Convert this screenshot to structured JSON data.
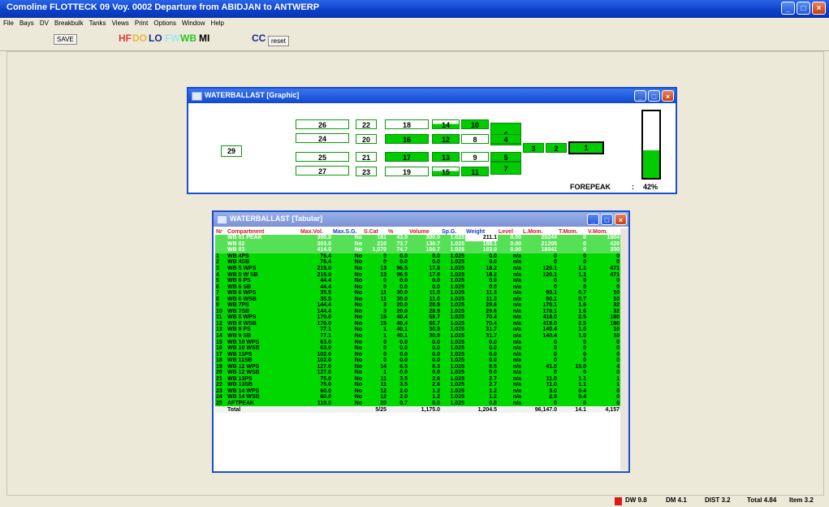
{
  "app": {
    "title": "Comoline FLOTTECK 09  Voy. 0002 Departure from ABIDJAN to ANTWERP",
    "menu": [
      "File",
      "Bays",
      "DV",
      "Breakbulk",
      "Tanks",
      "Views",
      "Print",
      "Options",
      "Window",
      "Help"
    ]
  },
  "toolbar": {
    "save": "SAVE",
    "hf": "HF",
    "do": "DO",
    "lo": "LO",
    "fw": "FW",
    "wb": "WB",
    "mi": "MI",
    "cc": "CC",
    "reset": "reset",
    "colors": {
      "hf": "#e23a3a",
      "do": "#e8b840",
      "lo": "#1a2a8a",
      "fw": "#9de8f0",
      "wb": "#26c826",
      "mi": "#000000"
    }
  },
  "graphic_window": {
    "title": "WATERBALLAST  [Graphic]",
    "tanks": {
      "t29": "29",
      "r1": [
        "26",
        "22",
        "18",
        "14",
        "10",
        "6"
      ],
      "r2": [
        "24",
        "20",
        "16",
        "12",
        "8",
        "4"
      ],
      "r3": [
        "25",
        "21",
        "17",
        "13",
        "9",
        "5"
      ],
      "r4": [
        "27",
        "23",
        "19",
        "15",
        "11",
        "7"
      ],
      "chain": [
        "3",
        "2",
        "1"
      ]
    },
    "selected_tank": "FOREPEAK",
    "selected_sep": ":",
    "selected_pct": "42%",
    "fill_level": 0.42
  },
  "table_window": {
    "title": "WATERBALLAST  [Tabular]",
    "headers": [
      "Nr",
      "Compartment",
      "Max.Vol.",
      "Max.S.G.",
      "S.Cat",
      "%",
      "Volume",
      "Sp.G.",
      "Weight",
      "Level",
      "L.Mom.",
      "T.Mom.",
      "V.Mom."
    ],
    "rows": [
      [
        "",
        "WB 01 PEAK",
        "300.0",
        "No",
        "161",
        "43.0",
        "300.0",
        "1.025",
        "211.1",
        "0.00",
        "20244",
        "0",
        "1604"
      ],
      [
        "",
        "WB 02",
        "303.0",
        "No",
        "210",
        "73.7",
        "130.7",
        "1.025",
        "188.1",
        "0.00",
        "21205",
        "0",
        "420"
      ],
      [
        "",
        "WB 03",
        "414.0",
        "No",
        "1,070",
        "74.7",
        "150.7",
        "1.025",
        "183.0",
        "0.00",
        "18041",
        "0",
        "350"
      ],
      [
        "1",
        "WB 4PS",
        "76.4",
        "No",
        "0",
        "0.0",
        "0.0",
        "1.025",
        "0.0",
        "n/a",
        "0",
        "0",
        "0"
      ],
      [
        "2",
        "WB 4SB",
        "76.4",
        "No",
        "0",
        "0.0",
        "0.0",
        "1.025",
        "0.0",
        "n/a",
        "0",
        "0",
        "0"
      ],
      [
        "3",
        "WB 5 WPS",
        "215.0",
        "No",
        "13",
        "96.5",
        "17.8",
        "1.025",
        "18.2",
        "n/a",
        "120.1",
        "1.1",
        "471"
      ],
      [
        "4",
        "WB 5 W SB",
        "215.0",
        "No",
        "13",
        "96.5",
        "17.8",
        "1.025",
        "18.2",
        "n/a",
        "120.1",
        "1.1",
        "471"
      ],
      [
        "5",
        "WB 6 PS",
        "44.4",
        "No",
        "0",
        "0.0",
        "0.0",
        "1.025",
        "0.0",
        "n/a",
        "0",
        "0",
        "0"
      ],
      [
        "6",
        "WB 6 SB",
        "44.4",
        "No",
        "0",
        "0.0",
        "0.0",
        "1.025",
        "0.0",
        "n/a",
        "0",
        "0",
        "0"
      ],
      [
        "7",
        "WB 6 WPS",
        "35.5",
        "No",
        "11",
        "30.0",
        "11.0",
        "1.025",
        "11.3",
        "n/a",
        "90.1",
        "0.7",
        "10"
      ],
      [
        "8",
        "WB 6 WSB",
        "35.5",
        "No",
        "11",
        "30.0",
        "11.0",
        "1.025",
        "11.3",
        "n/a",
        "90.1",
        "0.7",
        "10"
      ],
      [
        "9",
        "WB 7PS",
        "144.4",
        "No",
        "3",
        "20.0",
        "28.9",
        "1.025",
        "29.6",
        "n/a",
        "170.1",
        "1.6",
        "32"
      ],
      [
        "10",
        "WB 7SB",
        "144.4",
        "No",
        "3",
        "20.0",
        "28.9",
        "1.025",
        "29.6",
        "n/a",
        "170.1",
        "1.6",
        "32"
      ],
      [
        "11",
        "WB 8 WPS",
        "170.0",
        "No",
        "15",
        "40.4",
        "68.7",
        "1.025",
        "70.4",
        "n/a",
        "418.0",
        "2.5",
        "180"
      ],
      [
        "12",
        "WB 8 WSB",
        "170.0",
        "No",
        "15",
        "40.4",
        "68.7",
        "1.025",
        "70.4",
        "n/a",
        "418.0",
        "2.5",
        "180"
      ],
      [
        "13",
        "WB 9 PS",
        "77.1",
        "No",
        "1",
        "40.1",
        "30.9",
        "1.025",
        "31.7",
        "n/a",
        "140.4",
        "1.0",
        "10"
      ],
      [
        "14",
        "WB 9 SB",
        "77.1",
        "No",
        "1",
        "40.1",
        "30.9",
        "1.025",
        "31.7",
        "n/a",
        "140.4",
        "1.0",
        "10"
      ],
      [
        "15",
        "WB 10 WPS",
        "63.0",
        "No",
        "0",
        "0.0",
        "0.0",
        "1.025",
        "0.0",
        "n/a",
        "0",
        "0",
        "0"
      ],
      [
        "16",
        "WB 10 WSB",
        "63.0",
        "No",
        "0",
        "0.0",
        "0.0",
        "1.025",
        "0.0",
        "n/a",
        "0",
        "0",
        "0"
      ],
      [
        "17",
        "WB 11PS",
        "102.0",
        "No",
        "0",
        "0.0",
        "0.0",
        "1.025",
        "0.0",
        "n/a",
        "0",
        "0",
        "0"
      ],
      [
        "18",
        "WB 11SB",
        "102.0",
        "No",
        "0",
        "0.0",
        "0.0",
        "1.025",
        "0.0",
        "n/a",
        "0",
        "0",
        "0"
      ],
      [
        "19",
        "WB 12 WPS",
        "127.0",
        "No",
        "14",
        "6.5",
        "8.3",
        "1.025",
        "8.5",
        "n/a",
        "41.0",
        "15.0",
        "4"
      ],
      [
        "20",
        "WB 12 WSB",
        "127.0",
        "No",
        "1",
        "0.0",
        "0.0",
        "1.025",
        "0.0",
        "n/a",
        "0",
        "0",
        "0"
      ],
      [
        "21",
        "WB 13PS",
        "75.0",
        "No",
        "11",
        "3.5",
        "2.6",
        "1.025",
        "2.7",
        "n/a",
        "11.0",
        "1.1",
        "1"
      ],
      [
        "22",
        "WB 13SB",
        "75.0",
        "No",
        "11",
        "3.5",
        "2.6",
        "1.025",
        "2.7",
        "n/a",
        "11.0",
        "1.1",
        "1"
      ],
      [
        "23",
        "WB 14 WPS",
        "60.0",
        "No",
        "12",
        "2.0",
        "1.2",
        "1.025",
        "1.2",
        "n/a",
        "3.0",
        "0.4",
        "0"
      ],
      [
        "24",
        "WB 14 WSB",
        "60.0",
        "No",
        "12",
        "2.0",
        "1.2",
        "1.025",
        "1.2",
        "n/a",
        "2.9",
        "0.4",
        "0"
      ],
      [
        "25",
        "AFTPEAK",
        "110.0",
        "No",
        "20",
        "0.7",
        "0.8",
        "1.025",
        "0.8",
        "n/a",
        "0",
        "0",
        "0"
      ]
    ],
    "total": {
      "label": "Total",
      "scat": "5/25",
      "volume": "1,175.0",
      "weight": "1,204.5",
      "lmom": "96,147.0",
      "tmom": "14.1",
      "vmom": "4,157"
    }
  },
  "statusbar": {
    "dw": "DW 9.8",
    "dm": "DM 4.1",
    "dist": "DIST 3.2",
    "info": "Total 4.84",
    "item": "Item 3.2",
    "indicator_color": "#e01818"
  }
}
